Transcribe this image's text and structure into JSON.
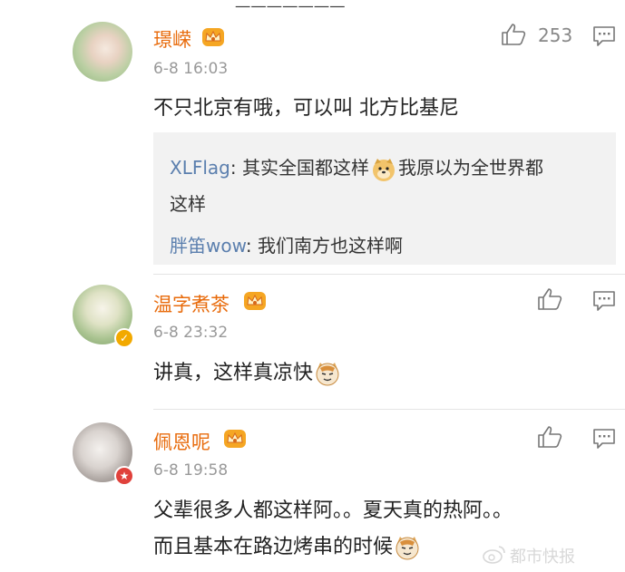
{
  "comments": [
    {
      "username": "璟嵘",
      "time": "6-8 16:03",
      "likes": "253",
      "text": "不只北京有哦，可以叫 北方比基尼",
      "replies": [
        {
          "who": "XLFlag",
          "sep": ": ",
          "text_a": "其实全国都这样",
          "text_b": "我原以为全世界都",
          "text_c": "这样"
        },
        {
          "who": "胖笛wow",
          "sep": ": ",
          "text_a": "我们南方也这样啊"
        }
      ]
    },
    {
      "username": "温字煮茶",
      "time": "6-8 23:32",
      "text": "讲真，这样真凉快"
    },
    {
      "username": "佩恩呢",
      "time": "6-8 19:58",
      "text_line1": "父辈很多人都这样阿。。夏天真的热阿。。",
      "text_line2": "而且基本在路边烤串的时候"
    }
  ],
  "watermark": "都市快报",
  "icons": {
    "like": "thumbs-up-icon",
    "reply": "comment-icon",
    "crown": "vip-crown-icon",
    "emoji_doge": "doge-emoji-icon",
    "emoji_cat": "cat-emoji-icon",
    "weibo": "weibo-logo-icon",
    "verified": "verified-badge-icon"
  },
  "colors": {
    "username": "#e86b0c",
    "reply_user": "#5b7fae",
    "reply_bg": "#f2f2f2",
    "time": "#999999"
  }
}
